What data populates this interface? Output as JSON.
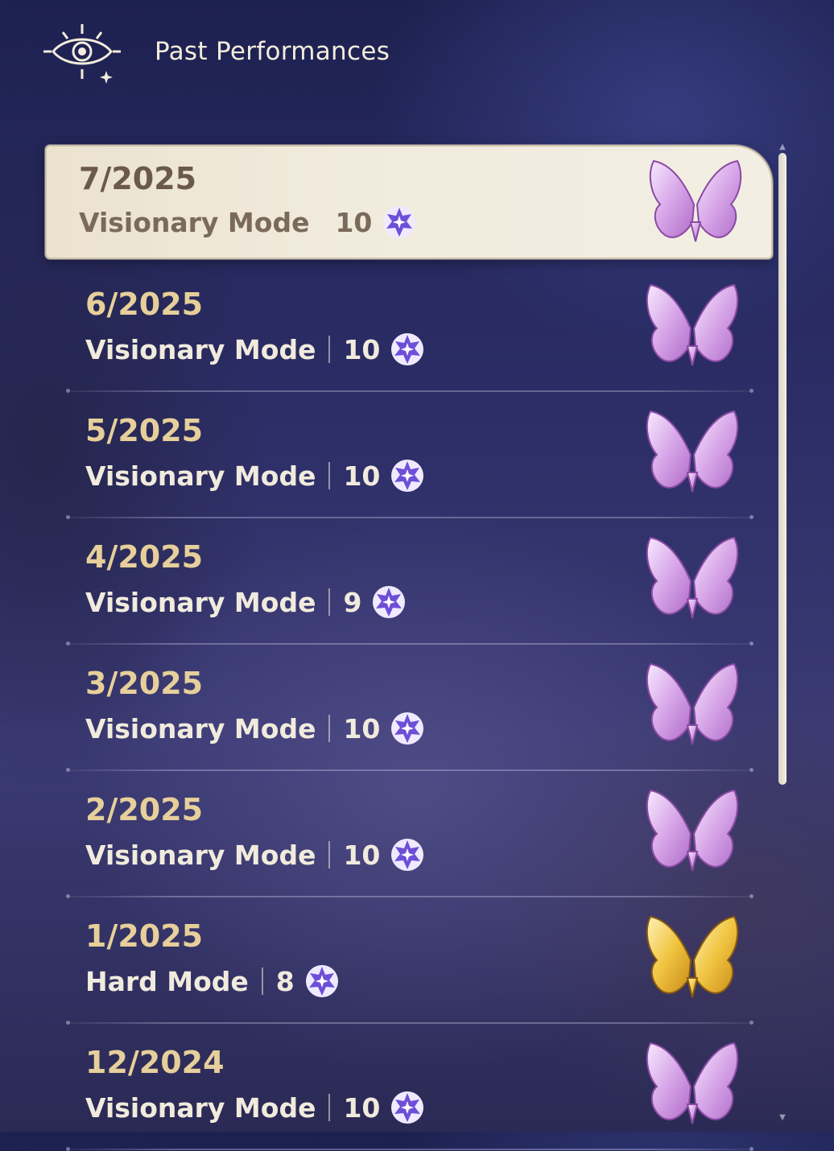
{
  "header": {
    "title": "Past Performances",
    "icon": "eye-sun-icon"
  },
  "colors": {
    "date_gold": "#e6cf9a",
    "text_light": "#f1ebdd",
    "selected_bg": "#f1ebdd",
    "star_purple": "#6d4fd8"
  },
  "records": [
    {
      "date": "7/2025",
      "mode": "Visionary Mode",
      "stars": "10",
      "emblem": "pink",
      "selected": true
    },
    {
      "date": "6/2025",
      "mode": "Visionary Mode",
      "stars": "10",
      "emblem": "pink"
    },
    {
      "date": "5/2025",
      "mode": "Visionary Mode",
      "stars": "10",
      "emblem": "pink"
    },
    {
      "date": "4/2025",
      "mode": "Visionary Mode",
      "stars": "9",
      "emblem": "pink"
    },
    {
      "date": "3/2025",
      "mode": "Visionary Mode",
      "stars": "10",
      "emblem": "pink"
    },
    {
      "date": "2/2025",
      "mode": "Visionary Mode",
      "stars": "10",
      "emblem": "pink"
    },
    {
      "date": "1/2025",
      "mode": "Hard Mode",
      "stars": "8",
      "emblem": "gold"
    },
    {
      "date": "12/2024",
      "mode": "Visionary Mode",
      "stars": "10",
      "emblem": "pink"
    }
  ]
}
